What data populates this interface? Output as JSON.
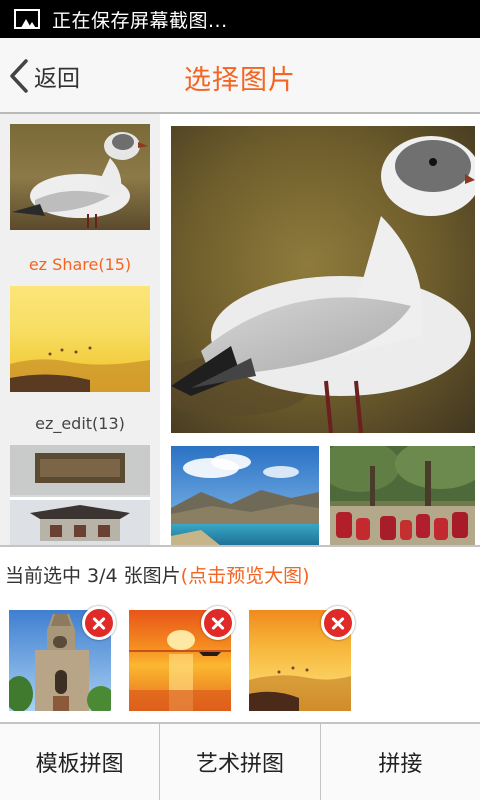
{
  "status_bar": {
    "icon": "image-icon",
    "text": "正在保存屏幕截图..."
  },
  "header": {
    "back_icon": "chevron-left-icon",
    "back_label": "返回",
    "title": "选择图片"
  },
  "albums": [
    {
      "label": "ez Share(15)",
      "active": true
    },
    {
      "label": "ez_edit(13)",
      "active": false
    }
  ],
  "selection": {
    "prefix": "当前选中 ",
    "count": "3/4",
    "suffix": " 张图片",
    "preview_link": "(点击预览大图)"
  },
  "selected_images": [
    {
      "name": "church-tower-photo",
      "remove_icon": "close-icon"
    },
    {
      "name": "sunset-sea-photo",
      "remove_icon": "close-icon"
    },
    {
      "name": "golden-shore-photo",
      "remove_icon": "close-icon"
    }
  ],
  "bottom_buttons": [
    {
      "label": "模板拼图"
    },
    {
      "label": "艺术拼图"
    },
    {
      "label": "拼接"
    }
  ],
  "colors": {
    "accent": "#f26522",
    "remove": "#e02a28"
  }
}
